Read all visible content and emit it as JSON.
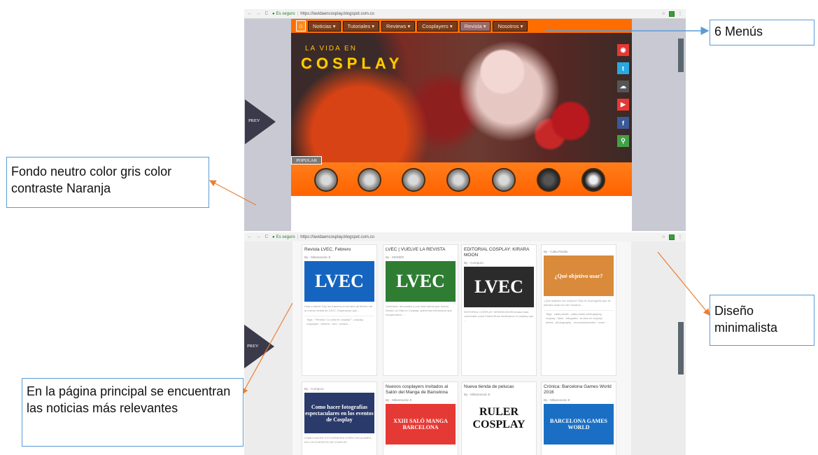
{
  "browser": {
    "secure_label": "Es seguro",
    "url": "https://lavidaencosplay.blogspot.com.co",
    "back_icon": "arrow-left-icon",
    "forward_icon": "arrow-right-icon",
    "reload_icon": "reload-icon"
  },
  "top_screenshot": {
    "menus": [
      "Noticias ▾",
      "Tutoriales ▾",
      "Reviews ▾",
      "Cosplayers ▾",
      "Revista ▾",
      "Nosotros ▾"
    ],
    "hero_small": "LA VIDA EN",
    "hero_big": "COSPLAY",
    "popular_label": "POPULAR",
    "prev_label": "PREV",
    "social": [
      {
        "icon": "rss-icon",
        "glyph": "◉",
        "color": "#e53935"
      },
      {
        "icon": "twitter-icon",
        "glyph": "t",
        "color": "#29a9e1"
      },
      {
        "icon": "soundcloud-icon",
        "glyph": "☁",
        "color": "#555555"
      },
      {
        "icon": "youtube-icon",
        "glyph": "▶",
        "color": "#e53935"
      },
      {
        "icon": "facebook-icon",
        "glyph": "f",
        "color": "#3b5998"
      },
      {
        "icon": "search-icon",
        "glyph": "⚲",
        "color": "#43a047"
      }
    ],
    "colors": {
      "accent": "#ff6d00",
      "background": "#c9c9d3"
    }
  },
  "bottom_screenshot": {
    "prev_label": "PREV",
    "cards_row1": [
      {
        "title": "Revista LVEC, Febrero",
        "by": "By - Mikaresonic E",
        "img_text": "LVEC",
        "img_color": "#1565c0",
        "excerpt": "Hola a todos! Hoy les traemos el número de febrero de la nueva revista de LVEC. Esperamos que ...",
        "tags": "Tags : \"Revista \"La vida en cosplay\"\", cosplay , cosplayer , febrero , lvec , revista ..."
      },
      {
        "title": "LVEC | VUELVE LA REVISTA",
        "by": "By - MODER",
        "img_text": "LVEC",
        "img_color": "#2e7d32",
        "excerpt": "Volvemos, renovados y con más fuerza que nunca. Desde La Vida en Cosplay, queremos informaros que recuperamos ...",
        "tags": ""
      },
      {
        "title": "EDITORIAL COSPLAY: KIRARA MOON",
        "by": "By - Compuro",
        "img_text": "LVEC",
        "img_color": "#2b2b2b",
        "excerpt": "EDITORIAL COSPLAY: KIRARA MOON Anata mata cosmmale como Kirara Moon dedicamos el cosplay que ...",
        "tags": ""
      },
      {
        "title": "",
        "by": "By - Catia Panda",
        "img_text": "¿Qué objetivo usar?",
        "img_color": "#d98a3a",
        "excerpt": "¿Qué objetivo me compro? Esa es la pregunta que se plantea cada uno de nosotros ...",
        "tags": "Tags : catia panda , catia panda photography , cosplay , flash , fotografía , la vida en cosplay , lentes , photography , recomendaciones , zoom ..."
      }
    ],
    "cards_row2": [
      {
        "title": "",
        "by": "By - Compuro",
        "img_text": "Como hacer fotografías espectaculares en los eventos de Cosplay",
        "img_color": "#2a3a6a",
        "excerpt": "CÓMO HACER FOTOGRAFÍAS ESPECTACULARES EN LOS EVENTOS DE COSPLAY",
        "tags": ""
      },
      {
        "title": "Nuevos cosplayers invitados al Salón del Manga de Barcelona",
        "by": "By - Mikaresonic E",
        "img_text": "XXIII SALÓ MANGA BARCELONA",
        "img_color": "#e53935",
        "excerpt": "",
        "tags": ""
      },
      {
        "title": "Nueva tienda de pelucas",
        "by": "By - Mikaresonic E",
        "img_text": "RULER COSPLAY",
        "img_color": "#ffffff",
        "excerpt": "",
        "tags": ""
      },
      {
        "title": "Crónica: Barcelona Games World 2016",
        "by": "By - Mikaresonic E",
        "img_text": "BARCELONA GAMES WORLD",
        "img_color": "#1a6fc4",
        "excerpt": "",
        "tags": ""
      }
    ]
  },
  "callouts": {
    "menus": "6 Menús",
    "fondo": "Fondo neutro color gris color contraste Naranja",
    "minimal": "Diseño minimalista",
    "principal": "En la página principal se encuentran las noticias más relevantes"
  }
}
